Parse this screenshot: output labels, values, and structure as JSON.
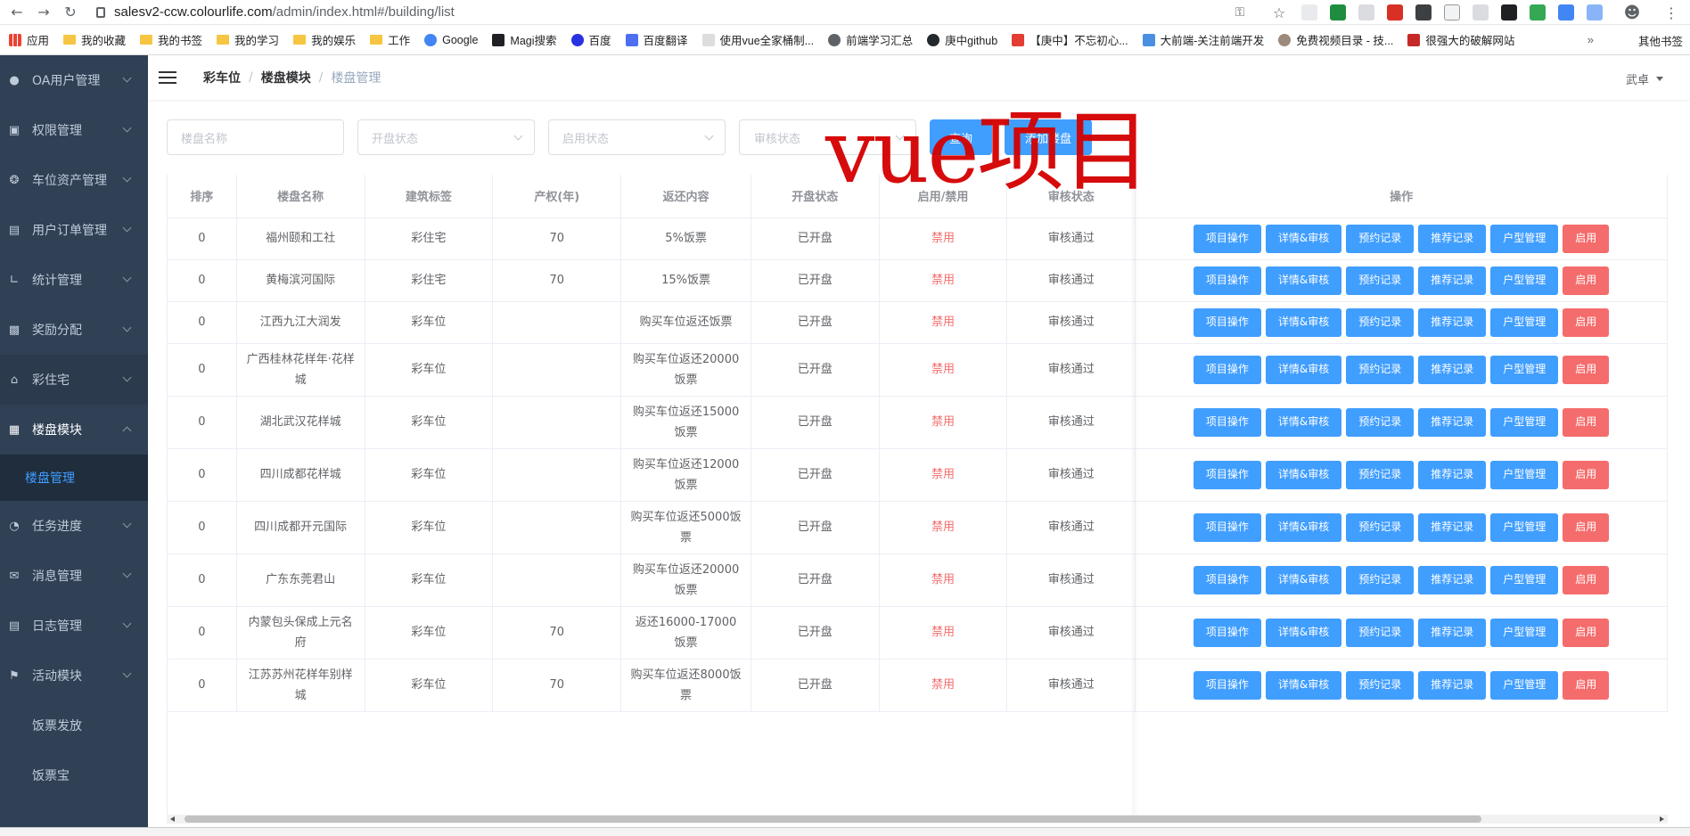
{
  "browser": {
    "url_host": "salesv2-ccw.colourlife.com",
    "url_path": "/admin/index.html#/building/list",
    "bookmarks": [
      "应用",
      "我的收藏",
      "我的书签",
      "我的学习",
      "我的娱乐",
      "工作",
      "Google",
      "Magi搜索",
      "百度",
      "百度翻译",
      "使用vue全家桶制...",
      "前端学习汇总",
      "庚中github",
      "【庚中】不忘初心...",
      "大前端-关注前端开发",
      "免费视频目录 - 技...",
      "很强大的破解网站"
    ],
    "bookmarks_more": "»",
    "other_bookmarks": "其他书签"
  },
  "sidebar": {
    "items": [
      {
        "label": "OA用户管理",
        "icon": "user-icon"
      },
      {
        "label": "权限管理",
        "icon": "lock-icon"
      },
      {
        "label": "车位资产管理",
        "icon": "dial-icon"
      },
      {
        "label": "用户订单管理",
        "icon": "document-icon"
      },
      {
        "label": "统计管理",
        "icon": "chart-icon"
      },
      {
        "label": "奖励分配",
        "icon": "briefcase-icon"
      },
      {
        "label": "彩住宅",
        "icon": "home-icon"
      },
      {
        "label": "楼盘模块",
        "icon": "building-icon"
      }
    ],
    "active_sub": "楼盘管理",
    "items_after": [
      {
        "label": "任务进度",
        "icon": "clock-icon"
      },
      {
        "label": "消息管理",
        "icon": "mail-icon"
      },
      {
        "label": "日志管理",
        "icon": "log-icon"
      },
      {
        "label": "活动模块",
        "icon": "flag-icon"
      }
    ],
    "sub_after": [
      "饭票发放",
      "饭票宝"
    ]
  },
  "navbar": {
    "breadcrumb": [
      "彩车位",
      "楼盘模块",
      "楼盘管理"
    ],
    "breadcrumb_sep": "/",
    "user": "武卓"
  },
  "filters": {
    "name_placeholder": "楼盘名称",
    "open_status_placeholder": "开盘状态",
    "enable_status_placeholder": "启用状态",
    "audit_status_placeholder": "审核状态",
    "query_label": "查询",
    "add_label": "添加楼盘"
  },
  "watermark": "vue项目",
  "table": {
    "headers": [
      "排序",
      "楼盘名称",
      "建筑标签",
      "产权(年)",
      "返还内容",
      "开盘状态",
      "启用/禁用",
      "审核状态",
      "操作"
    ],
    "ops": [
      "项目操作",
      "详情&审核",
      "预约记录",
      "推荐记录",
      "户型管理",
      "启用"
    ],
    "rows": [
      {
        "sort": "0",
        "name": "福州颐和工社",
        "tag": "彩住宅",
        "years": "70",
        "refund": "5%饭票",
        "open": "已开盘",
        "enable": "禁用",
        "audit": "审核通过"
      },
      {
        "sort": "0",
        "name": "黄梅滨河国际",
        "tag": "彩住宅",
        "years": "70",
        "refund": "15%饭票",
        "open": "已开盘",
        "enable": "禁用",
        "audit": "审核通过"
      },
      {
        "sort": "0",
        "name": "江西九江大润发",
        "tag": "彩车位",
        "years": "",
        "refund": "购买车位返还饭票",
        "open": "已开盘",
        "enable": "禁用",
        "audit": "审核通过"
      },
      {
        "sort": "0",
        "name": "广西桂林花样年·花样城",
        "tag": "彩车位",
        "years": "",
        "refund": "购买车位返还20000饭票",
        "open": "已开盘",
        "enable": "禁用",
        "audit": "审核通过"
      },
      {
        "sort": "0",
        "name": "湖北武汉花样城",
        "tag": "彩车位",
        "years": "",
        "refund": "购买车位返还15000饭票",
        "open": "已开盘",
        "enable": "禁用",
        "audit": "审核通过"
      },
      {
        "sort": "0",
        "name": "四川成都花样城",
        "tag": "彩车位",
        "years": "",
        "refund": "购买车位返还12000饭票",
        "open": "已开盘",
        "enable": "禁用",
        "audit": "审核通过"
      },
      {
        "sort": "0",
        "name": "四川成都开元国际",
        "tag": "彩车位",
        "years": "",
        "refund": "购买车位返还5000饭票",
        "open": "已开盘",
        "enable": "禁用",
        "audit": "审核通过"
      },
      {
        "sort": "0",
        "name": "广东东莞君山",
        "tag": "彩车位",
        "years": "",
        "refund": "购买车位返还20000饭票",
        "open": "已开盘",
        "enable": "禁用",
        "audit": "审核通过"
      },
      {
        "sort": "0",
        "name": "内蒙包头保成上元名府",
        "tag": "彩车位",
        "years": "70",
        "refund": "返还16000-17000饭票",
        "open": "已开盘",
        "enable": "禁用",
        "audit": "审核通过"
      },
      {
        "sort": "0",
        "name": "江苏苏州花样年别样城",
        "tag": "彩车位",
        "years": "70",
        "refund": "购买车位返还8000饭票",
        "open": "已开盘",
        "enable": "禁用",
        "audit": "审核通过"
      }
    ]
  },
  "colors": {
    "primary": "#409eff",
    "danger": "#f56c6c",
    "sidebar_bg": "#304156",
    "watermark": "#d40000"
  }
}
